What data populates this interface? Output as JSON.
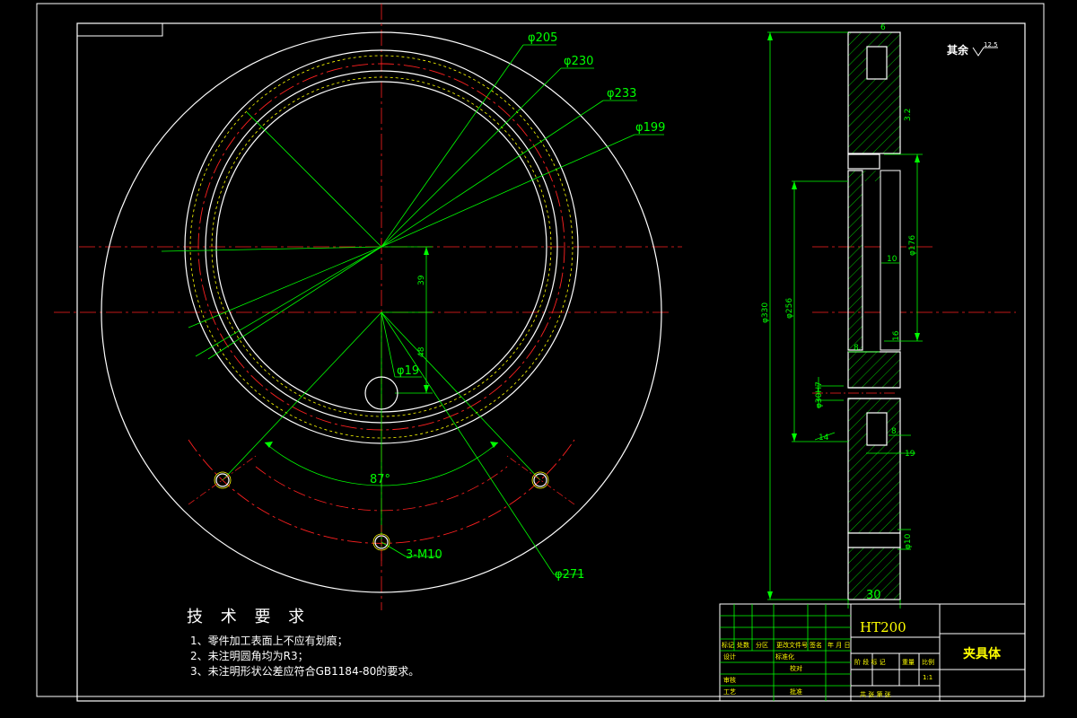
{
  "drawing": {
    "front_view": {
      "dimensions": {
        "d205": "φ205",
        "d230": "φ230",
        "d233": "φ233",
        "d199": "φ199",
        "d271": "φ271",
        "d19": "φ19",
        "dist39": "39",
        "dist48": "48",
        "angle87": "87°",
        "tapped_holes": "3-M10"
      }
    },
    "section_view": {
      "dimensions": {
        "d330": "φ330",
        "d256": "φ256",
        "d176": "φ176",
        "thick10": "10",
        "w8a": "8",
        "w8b": "8",
        "w19": "19",
        "w30": "30",
        "ch14": "14",
        "s16": "16",
        "ra": "3.2",
        "bore": "φ30H7",
        "hole_sm": "φ10",
        "d6": "6"
      }
    },
    "surface_note": {
      "label": "其余",
      "ra": "12.5"
    }
  },
  "technical_requirements": {
    "title": "技 术 要 求",
    "items": [
      "1、零件加工表面上不应有划痕；",
      "2、未注明圆角均为R3；",
      "3、未注明形状公差应符合GB1184-80的要求。"
    ]
  },
  "title_block": {
    "material": "HT200",
    "part_name": "夹具体",
    "scale": "1:1",
    "row_labels": {
      "mark": "标记",
      "count": "处数",
      "zone": "分区",
      "doc_no": "更改文件号",
      "sign": "签名",
      "date": "年 月 日",
      "design": "设计",
      "standard": "标准化",
      "review": "审核",
      "process": "工艺",
      "approve": "批准",
      "check": "校对",
      "stage": "阶 段 标 记",
      "weight": "重量",
      "ratio": "比例",
      "total_sheets": "共  张  第  张"
    }
  }
}
